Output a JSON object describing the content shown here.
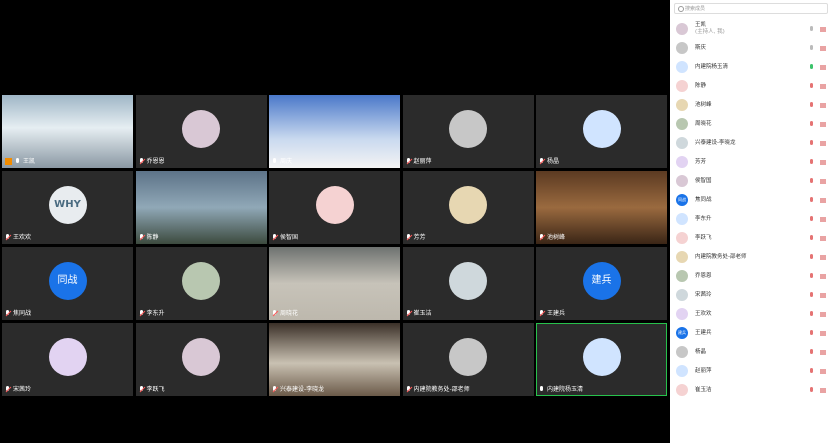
{
  "colors": {
    "tile_bg": "#2b2b2b",
    "active_border": "#27c24c",
    "avatar_blue": "#1a73e8",
    "muted": "#ff5a5a"
  },
  "tiles": [
    {
      "name": "王凯",
      "kind": "video",
      "mic": "on",
      "host": true
    },
    {
      "name": "乔恩恩",
      "kind": "avatar",
      "mic": "muted"
    },
    {
      "name": "周庆",
      "kind": "video",
      "mic": "on"
    },
    {
      "name": "赵丽萍",
      "kind": "avatar",
      "mic": "muted"
    },
    {
      "name": "杨晶",
      "kind": "avatar",
      "mic": "muted"
    },
    {
      "name": "王欢欢",
      "kind": "avatar",
      "mic": "muted",
      "avatar_text": "WHY"
    },
    {
      "name": "陈静",
      "kind": "video",
      "mic": "muted"
    },
    {
      "name": "侯智国",
      "kind": "avatar",
      "mic": "muted"
    },
    {
      "name": "芳芳",
      "kind": "avatar",
      "mic": "muted"
    },
    {
      "name": "池树峰",
      "kind": "video",
      "mic": "muted"
    },
    {
      "name": "焦同战",
      "kind": "avatar",
      "mic": "muted",
      "avatar_text": "同战"
    },
    {
      "name": "李东升",
      "kind": "avatar",
      "mic": "muted"
    },
    {
      "name": "周晓花",
      "kind": "video",
      "mic": "muted"
    },
    {
      "name": "崔玉洁",
      "kind": "avatar",
      "mic": "muted"
    },
    {
      "name": "王建兵",
      "kind": "avatar",
      "mic": "muted",
      "avatar_text": "建兵"
    },
    {
      "name": "宋茜玲",
      "kind": "avatar",
      "mic": "muted"
    },
    {
      "name": "李跃飞",
      "kind": "avatar",
      "mic": "muted"
    },
    {
      "name": "兴泰建设-李晓龙",
      "kind": "video",
      "mic": "muted"
    },
    {
      "name": "内建院教务处-邵老师",
      "kind": "avatar",
      "mic": "muted"
    },
    {
      "name": "内建院杨玉清",
      "kind": "avatar",
      "mic": "on",
      "active": true
    }
  ],
  "panel": {
    "search_placeholder": "搜索成员",
    "members": [
      {
        "name": "王凯",
        "sub": "(主持人, 我)",
        "state": "off"
      },
      {
        "name": "斯庆",
        "state": "off"
      },
      {
        "name": "内建院杨玉清",
        "state": "on"
      },
      {
        "name": "陈静",
        "state": "muted"
      },
      {
        "name": "池树峰",
        "state": "muted"
      },
      {
        "name": "周晓花",
        "state": "muted"
      },
      {
        "name": "兴泰建设-李晓龙",
        "state": "muted"
      },
      {
        "name": "芳芳",
        "state": "muted"
      },
      {
        "name": "侯智国",
        "state": "muted"
      },
      {
        "name": "焦同战",
        "state": "muted",
        "avatar_text": "同战"
      },
      {
        "name": "李东升",
        "state": "muted"
      },
      {
        "name": "李跃飞",
        "state": "muted"
      },
      {
        "name": "内建院教务处-邵老师",
        "state": "muted"
      },
      {
        "name": "乔恩恩",
        "state": "muted"
      },
      {
        "name": "宋茜玲",
        "state": "muted"
      },
      {
        "name": "王欢欢",
        "state": "muted"
      },
      {
        "name": "王建兵",
        "state": "muted",
        "avatar_text": "建兵"
      },
      {
        "name": "杨晶",
        "state": "muted"
      },
      {
        "name": "赵丽萍",
        "state": "muted"
      },
      {
        "name": "崔玉洁",
        "state": "muted"
      }
    ]
  }
}
